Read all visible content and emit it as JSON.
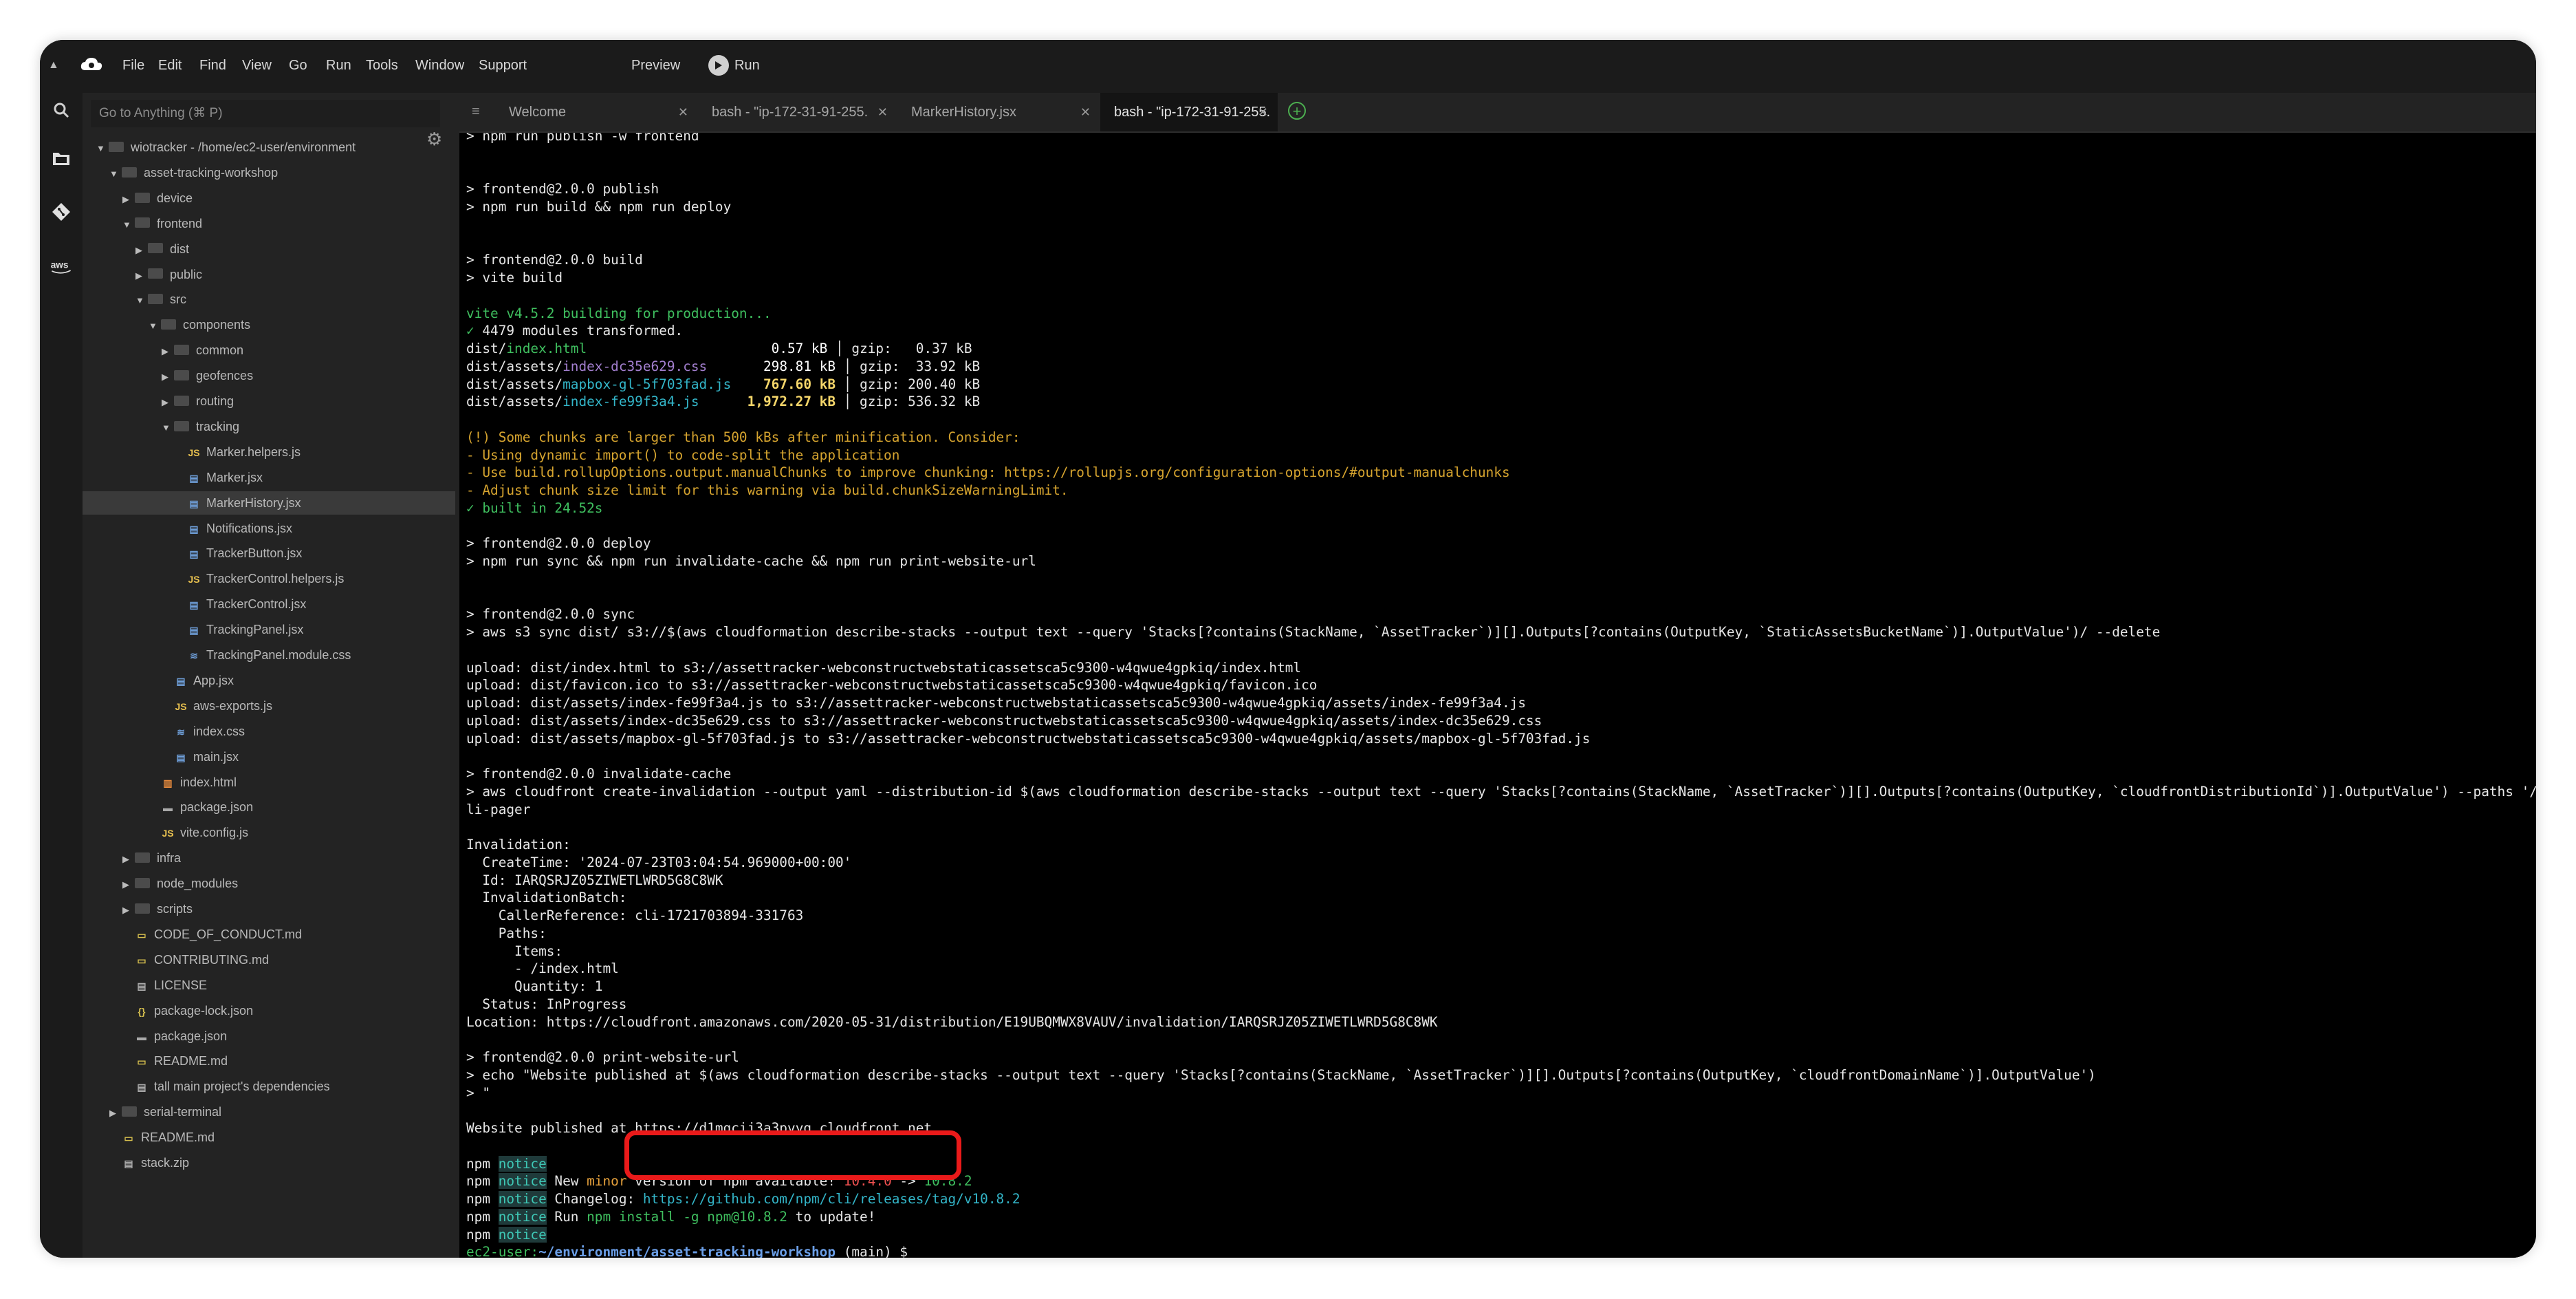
{
  "menubar": {
    "items": [
      "File",
      "Edit",
      "Find",
      "View",
      "Go",
      "Run",
      "Tools",
      "Window",
      "Support"
    ],
    "preview_label": "Preview",
    "run_label": "Run"
  },
  "sidebar": {
    "goto_placeholder": "Go to Anything (⌘ P)",
    "tree": [
      {
        "label": "wiotracker - /home/ec2-user/environment",
        "type": "folder",
        "open": true,
        "depth": 0
      },
      {
        "label": "asset-tracking-workshop",
        "type": "folder",
        "open": true,
        "depth": 1
      },
      {
        "label": "device",
        "type": "folder",
        "open": false,
        "depth": 2
      },
      {
        "label": "frontend",
        "type": "folder",
        "open": true,
        "depth": 2
      },
      {
        "label": "dist",
        "type": "folder",
        "open": false,
        "depth": 3
      },
      {
        "label": "public",
        "type": "folder",
        "open": false,
        "depth": 3
      },
      {
        "label": "src",
        "type": "folder",
        "open": true,
        "depth": 3
      },
      {
        "label": "components",
        "type": "folder",
        "open": true,
        "depth": 4
      },
      {
        "label": "common",
        "type": "folder",
        "open": false,
        "depth": 5
      },
      {
        "label": "geofences",
        "type": "folder",
        "open": false,
        "depth": 5
      },
      {
        "label": "routing",
        "type": "folder",
        "open": false,
        "depth": 5
      },
      {
        "label": "tracking",
        "type": "folder",
        "open": true,
        "depth": 5
      },
      {
        "label": "Marker.helpers.js",
        "type": "js",
        "depth": 6
      },
      {
        "label": "Marker.jsx",
        "type": "jsx",
        "depth": 6
      },
      {
        "label": "MarkerHistory.jsx",
        "type": "jsx",
        "depth": 6,
        "selected": true
      },
      {
        "label": "Notifications.jsx",
        "type": "jsx",
        "depth": 6
      },
      {
        "label": "TrackerButton.jsx",
        "type": "jsx",
        "depth": 6
      },
      {
        "label": "TrackerControl.helpers.js",
        "type": "js",
        "depth": 6
      },
      {
        "label": "TrackerControl.jsx",
        "type": "jsx",
        "depth": 6
      },
      {
        "label": "TrackingPanel.jsx",
        "type": "jsx",
        "depth": 6
      },
      {
        "label": "TrackingPanel.module.css",
        "type": "css",
        "depth": 6
      },
      {
        "label": "App.jsx",
        "type": "jsx",
        "depth": 5
      },
      {
        "label": "aws-exports.js",
        "type": "js",
        "depth": 5
      },
      {
        "label": "index.css",
        "type": "css",
        "depth": 5
      },
      {
        "label": "main.jsx",
        "type": "jsx",
        "depth": 5
      },
      {
        "label": "index.html",
        "type": "html",
        "depth": 4
      },
      {
        "label": "package.json",
        "type": "json",
        "depth": 4
      },
      {
        "label": "vite.config.js",
        "type": "js",
        "depth": 4
      },
      {
        "label": "infra",
        "type": "folder",
        "open": false,
        "depth": 2
      },
      {
        "label": "node_modules",
        "type": "folder",
        "open": false,
        "depth": 2
      },
      {
        "label": "scripts",
        "type": "folder",
        "open": false,
        "depth": 2
      },
      {
        "label": "CODE_OF_CONDUCT.md",
        "type": "md",
        "depth": 2
      },
      {
        "label": "CONTRIBUTING.md",
        "type": "md",
        "depth": 2
      },
      {
        "label": "LICENSE",
        "type": "plain",
        "depth": 2
      },
      {
        "label": "package-lock.json",
        "type": "json-brace",
        "depth": 2
      },
      {
        "label": "package.json",
        "type": "json",
        "depth": 2
      },
      {
        "label": "README.md",
        "type": "md",
        "depth": 2
      },
      {
        "label": "tall main project's dependencies",
        "type": "plain",
        "depth": 2
      },
      {
        "label": "serial-terminal",
        "type": "folder",
        "open": false,
        "depth": 1
      },
      {
        "label": "README.md",
        "type": "md",
        "depth": 1
      },
      {
        "label": "stack.zip",
        "type": "plain",
        "depth": 1
      }
    ]
  },
  "tabs": [
    {
      "label": "Welcome",
      "active": false
    },
    {
      "label": "bash - \"ip-172-31-91-255.",
      "active": false
    },
    {
      "label": "MarkerHistory.jsx",
      "active": false
    },
    {
      "label": "bash - \"ip-172-31-91-255.",
      "active": true
    }
  ],
  "terminal": {
    "lines": [
      [
        {
          "t": "> npm run publish -w frontend"
        }
      ],
      [],
      [],
      [
        {
          "t": "> frontend@2.0.0 publish"
        }
      ],
      [
        {
          "t": "> npm run build && npm run deploy"
        }
      ],
      [],
      [],
      [
        {
          "t": "> frontend@2.0.0 build"
        }
      ],
      [
        {
          "t": "> vite build"
        }
      ],
      [],
      [
        {
          "t": "vite v4.5.2 building for production...",
          "c": "c-green"
        }
      ],
      [
        {
          "t": "✓",
          "c": "c-green"
        },
        {
          "t": " 4479 modules transformed."
        }
      ],
      [
        {
          "t": "dist/"
        },
        {
          "t": "index.html",
          "c": "c-green"
        },
        {
          "t": "                       "
        },
        {
          "t": "0.57 kB",
          "c": "c-white"
        },
        {
          "t": " │ gzip:   0.37 kB"
        }
      ],
      [
        {
          "t": "dist/assets/"
        },
        {
          "t": "index-dc35e629.css",
          "c": "c-pur"
        },
        {
          "t": "       "
        },
        {
          "t": "298.81 kB",
          "c": "c-white"
        },
        {
          "t": " │ gzip:  33.92 kB"
        }
      ],
      [
        {
          "t": "dist/assets/"
        },
        {
          "t": "mapbox-gl-5f703fad.js",
          "c": "c-cyan"
        },
        {
          "t": "    "
        },
        {
          "t": "767.60 kB",
          "c": "c-bright"
        },
        {
          "t": " │ gzip: 200.40 kB"
        }
      ],
      [
        {
          "t": "dist/assets/"
        },
        {
          "t": "index-fe99f3a4.js",
          "c": "c-cyan"
        },
        {
          "t": "      "
        },
        {
          "t": "1,972.27 kB",
          "c": "c-bright"
        },
        {
          "t": " │ gzip: 536.32 kB"
        }
      ],
      [],
      [
        {
          "t": "(!) Some chunks are larger than 500 kBs after minification. Consider:",
          "c": "c-yellow"
        }
      ],
      [
        {
          "t": "- Using dynamic import() to code-split the application",
          "c": "c-yellow"
        }
      ],
      [
        {
          "t": "- Use build.rollupOptions.output.manualChunks to improve chunking: https://rollupjs.org/configuration-options/#output-manualchunks",
          "c": "c-yellow"
        }
      ],
      [
        {
          "t": "- Adjust chunk size limit for this warning via build.chunkSizeWarningLimit.",
          "c": "c-yellow"
        }
      ],
      [
        {
          "t": "✓ built in 24.52s",
          "c": "c-green"
        }
      ],
      [],
      [
        {
          "t": "> frontend@2.0.0 deploy"
        }
      ],
      [
        {
          "t": "> npm run sync && npm run invalidate-cache && npm run print-website-url"
        }
      ],
      [],
      [],
      [
        {
          "t": "> frontend@2.0.0 sync"
        }
      ],
      [
        {
          "t": "> aws s3 sync dist/ s3://$(aws cloudformation describe-stacks --output text --query 'Stacks[?contains(StackName, `AssetTracker`)][].Outputs[?contains(OutputKey, `StaticAssetsBucketName`)].OutputValue')/ --delete"
        }
      ],
      [],
      [
        {
          "t": "upload: dist/index.html to s3://assettracker-webconstructwebstaticassetsca5c9300-w4qwue4gpkiq/index.html"
        }
      ],
      [
        {
          "t": "upload: dist/favicon.ico to s3://assettracker-webconstructwebstaticassetsca5c9300-w4qwue4gpkiq/favicon.ico"
        }
      ],
      [
        {
          "t": "upload: dist/assets/index-fe99f3a4.js to s3://assettracker-webconstructwebstaticassetsca5c9300-w4qwue4gpkiq/assets/index-fe99f3a4.js"
        }
      ],
      [
        {
          "t": "upload: dist/assets/index-dc35e629.css to s3://assettracker-webconstructwebstaticassetsca5c9300-w4qwue4gpkiq/assets/index-dc35e629.css"
        }
      ],
      [
        {
          "t": "upload: dist/assets/mapbox-gl-5f703fad.js to s3://assettracker-webconstructwebstaticassetsca5c9300-w4qwue4gpkiq/assets/mapbox-gl-5f703fad.js"
        }
      ],
      [],
      [
        {
          "t": "> frontend@2.0.0 invalidate-cache"
        }
      ],
      [
        {
          "t": "> aws cloudfront create-invalidation --output yaml --distribution-id $(aws cloudformation describe-stacks --output text --query 'Stacks[?contains(StackName, `AssetTracker`)][].Outputs[?contains(OutputKey, `cloudfrontDistributionId`)].OutputValue') --paths '/index.h"
        }
      ],
      [
        {
          "t": "li-pager"
        }
      ],
      [],
      [
        {
          "t": "Invalidation:"
        }
      ],
      [
        {
          "t": "  CreateTime: '2024-07-23T03:04:54.969000+00:00'"
        }
      ],
      [
        {
          "t": "  Id: IARQSRJZ05ZIWETLWRD5G8C8WK"
        }
      ],
      [
        {
          "t": "  InvalidationBatch:"
        }
      ],
      [
        {
          "t": "    CallerReference: cli-1721703894-331763"
        }
      ],
      [
        {
          "t": "    Paths:"
        }
      ],
      [
        {
          "t": "      Items:"
        }
      ],
      [
        {
          "t": "      - /index.html"
        }
      ],
      [
        {
          "t": "      Quantity: 1"
        }
      ],
      [
        {
          "t": "  Status: InProgress"
        }
      ],
      [
        {
          "t": "Location: https://cloudfront.amazonaws.com/2020-05-31/distribution/E19UBQMWX8VAUV/invalidation/IARQSRJZ05ZIWETLWRD5G8C8WK"
        }
      ],
      [],
      [
        {
          "t": "> frontend@2.0.0 print-website-url"
        }
      ],
      [
        {
          "t": "> echo \"Website published at $(aws cloudformation describe-stacks --output text --query 'Stacks[?contains(StackName, `AssetTracker`)][].Outputs[?contains(OutputKey, `cloudfrontDomainName`)].OutputValue')"
        }
      ],
      [
        {
          "t": "> \""
        }
      ],
      [],
      [
        {
          "t": "Website published at https://d1mgcij3a3pvyg.cloudfront.net"
        }
      ],
      [],
      [
        {
          "t": "npm "
        },
        {
          "t": "notice",
          "c": "npm-notice"
        }
      ],
      [
        {
          "t": "npm "
        },
        {
          "t": "notice",
          "c": "npm-notice"
        },
        {
          "t": " New "
        },
        {
          "t": "minor",
          "c": "c-orange"
        },
        {
          "t": " version of npm available! "
        },
        {
          "t": "10.4.0",
          "c": "c-red"
        },
        {
          "t": " -> "
        },
        {
          "t": "10.8.2",
          "c": "c-green"
        }
      ],
      [
        {
          "t": "npm "
        },
        {
          "t": "notice",
          "c": "npm-notice"
        },
        {
          "t": " Changelog: "
        },
        {
          "t": "https://github.com/npm/cli/releases/tag/v10.8.2",
          "c": "c-cyan"
        }
      ],
      [
        {
          "t": "npm "
        },
        {
          "t": "notice",
          "c": "npm-notice"
        },
        {
          "t": " Run "
        },
        {
          "t": "npm install -g npm@10.8.2",
          "c": "c-green"
        },
        {
          "t": " to update!"
        }
      ],
      [
        {
          "t": "npm "
        },
        {
          "t": "notice",
          "c": "npm-notice"
        }
      ],
      [
        {
          "t": "ec2-user:",
          "c": "c-green"
        },
        {
          "t": "~/environment/asset-tracking-workshop",
          "c": "c-blue"
        },
        {
          "t": " (main) $"
        }
      ],
      [
        {
          "t": "ec2-user:",
          "c": "c-green"
        },
        {
          "t": "~/environment/asset-tracking-workshop",
          "c": "c-blue"
        },
        {
          "t": " (main) $"
        }
      ]
    ]
  }
}
